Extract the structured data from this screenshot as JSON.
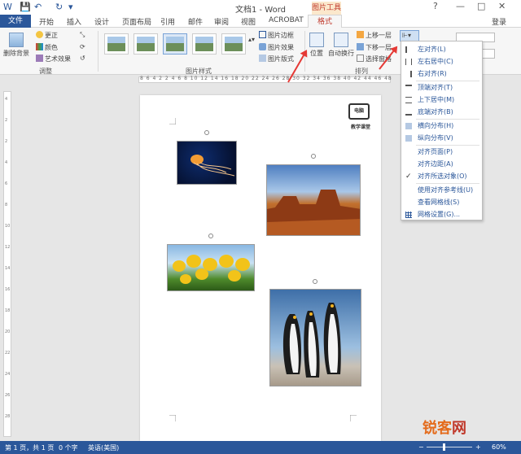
{
  "window": {
    "title": "文档1 - Word",
    "context_group": "图片工具",
    "login": "登录",
    "controls": {
      "help": "?",
      "minimize": "—",
      "restore": "□",
      "close": "✕"
    }
  },
  "quick_access": {
    "save": "💾",
    "undo": "↶",
    "redo": "↻",
    "customize": "▾"
  },
  "tabs": [
    {
      "label": "文件"
    },
    {
      "label": "开始"
    },
    {
      "label": "插入"
    },
    {
      "label": "设计"
    },
    {
      "label": "页面布局"
    },
    {
      "label": "引用"
    },
    {
      "label": "邮件"
    },
    {
      "label": "审阅"
    },
    {
      "label": "视图"
    },
    {
      "label": "ACROBAT"
    },
    {
      "label": "格式"
    }
  ],
  "ribbon": {
    "adjust": {
      "remove_bg": "删除背景",
      "corrections": "更正",
      "color": "颜色",
      "artistic": "艺术效果",
      "label": "调整"
    },
    "picture_styles": {
      "border": "图片边框",
      "effects": "图片效果",
      "layout": "图片版式",
      "label": "图片样式"
    },
    "arrange": {
      "position": "位置",
      "wrap": "自动换行",
      "bring_forward": "上移一层",
      "send_backward": "下移一层",
      "selection_pane": "选择窗格",
      "label": "排列"
    }
  },
  "ruler": {
    "top": "8 6 4 2  2 4 6 8 10 12 14 16 18 20 22 24 26 28 30 32 34 36 38 40 42 44 46 48",
    "left": [
      "4",
      "2",
      "2",
      "4",
      "6",
      "8",
      "10",
      "12",
      "14",
      "16",
      "18",
      "20",
      "22",
      "24",
      "26",
      "28"
    ]
  },
  "logo": {
    "text": "电脑",
    "subtitle": "教学课堂"
  },
  "align_menu": {
    "items": [
      {
        "label": "左对齐(L)"
      },
      {
        "label": "左右居中(C)"
      },
      {
        "label": "右对齐(R)"
      },
      {
        "label": "顶端对齐(T)"
      },
      {
        "label": "上下居中(M)"
      },
      {
        "label": "底端对齐(B)"
      },
      {
        "label": "横向分布(H)"
      },
      {
        "label": "纵向分布(V)"
      },
      {
        "label": "对齐页面(P)"
      },
      {
        "label": "对齐边距(A)"
      },
      {
        "label": "对齐所选对象(O)",
        "checked": true
      },
      {
        "label": "使用对齐参考线(U)"
      },
      {
        "label": "查看网格线(S)"
      },
      {
        "label": "网格设置(G)..."
      }
    ]
  },
  "status": {
    "page": "第 1 页，共 1 页",
    "words": "0 个字",
    "language": "英语(美国)",
    "zoom": "60%",
    "zoom_minus": "−",
    "zoom_plus": "+"
  },
  "watermark": {
    "part1": "锐客",
    "part2": "网"
  },
  "colors": {
    "accent": "#2b579a",
    "highlight": "#e53935",
    "context_tab": "#c0392b"
  }
}
